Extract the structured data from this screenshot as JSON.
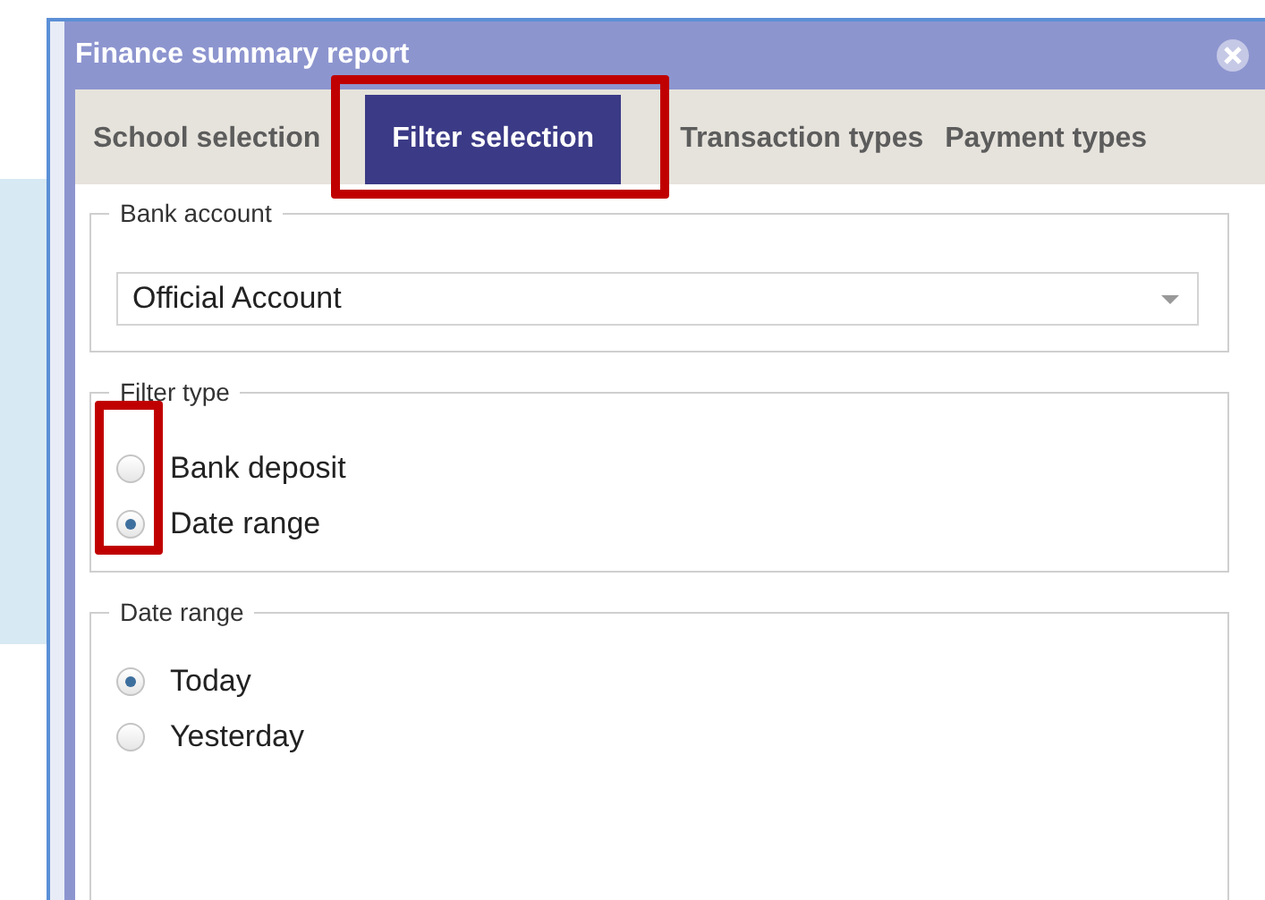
{
  "dialog": {
    "title": "Finance summary report"
  },
  "tabs": [
    {
      "label": "School selection",
      "selected": false,
      "highlighted": false
    },
    {
      "label": "Filter selection",
      "selected": true,
      "highlighted": true
    },
    {
      "label": "Transaction types",
      "selected": false,
      "highlighted": false
    },
    {
      "label": "Payment types",
      "selected": false,
      "highlighted": false
    }
  ],
  "bank_account": {
    "legend": "Bank account",
    "value": "Official Account"
  },
  "filter_type": {
    "legend": "Filter type",
    "highlighted": true,
    "options": [
      {
        "label": "Bank deposit",
        "selected": false
      },
      {
        "label": "Date range",
        "selected": true
      }
    ]
  },
  "date_range": {
    "legend": "Date range",
    "options": [
      {
        "label": "Today",
        "selected": true
      },
      {
        "label": "Yesterday",
        "selected": false
      }
    ]
  }
}
